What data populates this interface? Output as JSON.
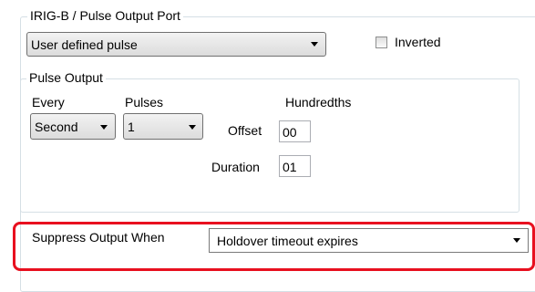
{
  "port_group": {
    "title": "IRIG-B / Pulse Output Port",
    "mode_select_value": "User defined pulse",
    "inverted_label": "Inverted",
    "inverted_checked": false
  },
  "pulse_output": {
    "title": "Pulse Output",
    "every_label": "Every",
    "every_value": "Second",
    "pulses_label": "Pulses",
    "pulses_value": "1",
    "hundredths_label": "Hundredths",
    "offset_label": "Offset",
    "offset_value": "00",
    "duration_label": "Duration",
    "duration_value": "01"
  },
  "suppress": {
    "label": "Suppress Output When",
    "value": "Holdover timeout expires",
    "highlight_color": "#e8101f"
  }
}
